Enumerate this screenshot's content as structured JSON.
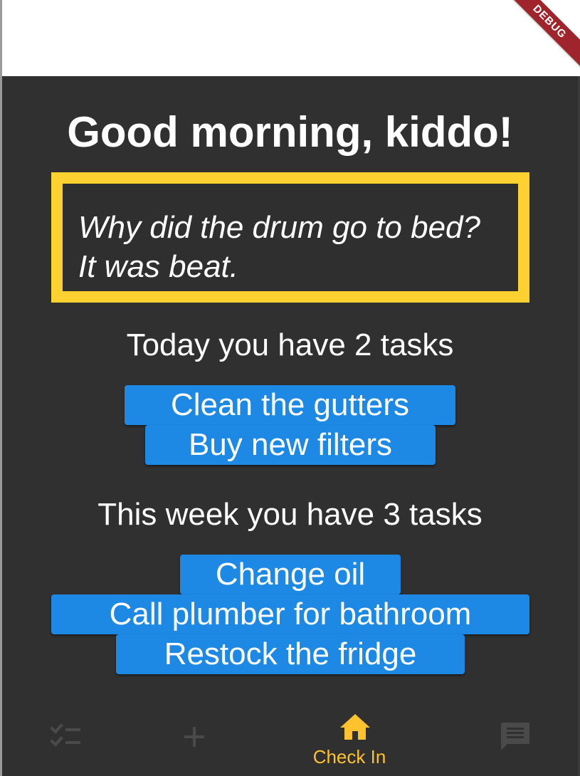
{
  "greeting": "Good morning, kiddo!",
  "joke": "Why did the drum go to bed? It was beat.",
  "today": {
    "heading": "Today you have 2 tasks",
    "tasks": [
      "Clean the gutters",
      "Buy new filters"
    ]
  },
  "week": {
    "heading": "This week you have 3 tasks",
    "tasks": [
      "Change oil",
      "Call plumber for bathroom",
      "Restock the fridge"
    ]
  },
  "nav": {
    "items": [
      {
        "icon": "checklist-icon",
        "label": "",
        "active": false
      },
      {
        "icon": "add-icon",
        "label": "",
        "active": false
      },
      {
        "icon": "home-icon",
        "label": "Check In",
        "active": true
      },
      {
        "icon": "chat-icon",
        "label": "",
        "active": false
      }
    ]
  },
  "debug_banner": "DEBUG",
  "colors": {
    "background": "#303030",
    "accent": "#fdc22e",
    "joke_border": "#fdd12f",
    "task_chip": "#1e88e5",
    "nav_inactive": "#4a4a4a",
    "debug_banner": "#a0242b"
  }
}
